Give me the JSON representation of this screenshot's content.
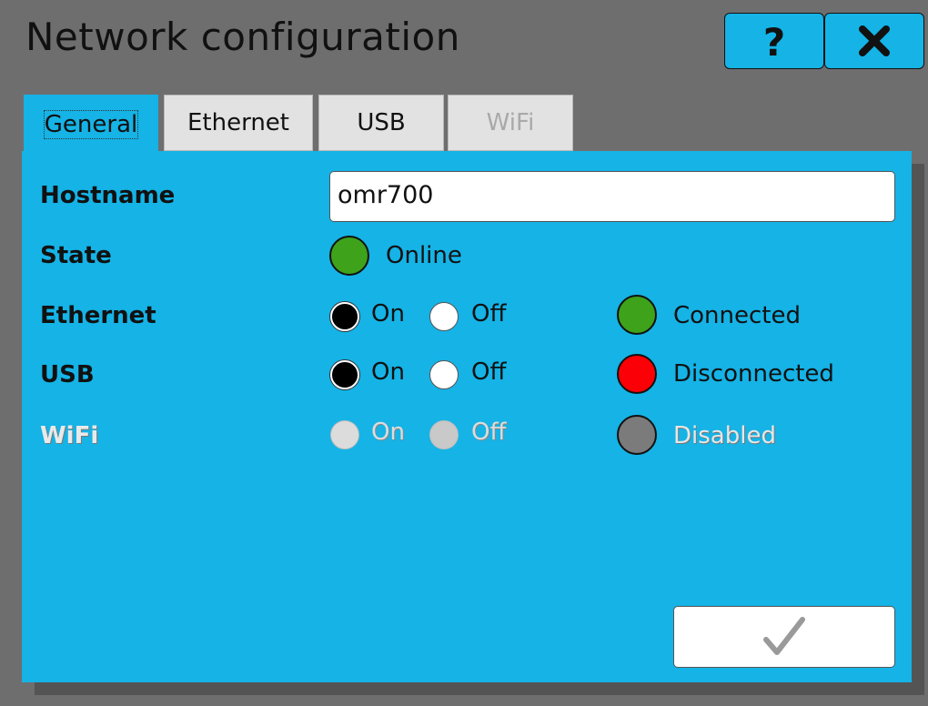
{
  "window": {
    "title": "Network configuration"
  },
  "toolbar": {
    "help_icon": "question-mark-icon",
    "close_icon": "close-x-icon"
  },
  "tabs": [
    {
      "label": "General",
      "state": "active"
    },
    {
      "label": "Ethernet",
      "state": "normal"
    },
    {
      "label": "USB",
      "state": "normal"
    },
    {
      "label": "WiFi",
      "state": "disabled"
    }
  ],
  "general": {
    "hostname": {
      "label": "Hostname",
      "value": "omr700"
    },
    "state": {
      "label": "State",
      "status": "Online",
      "color": "#3ea21a"
    },
    "ethernet": {
      "label": "Ethernet",
      "on": "On",
      "off": "Off",
      "selected": "On",
      "status": "Connected",
      "color": "#3ea21a"
    },
    "usb": {
      "label": "USB",
      "on": "On",
      "off": "Off",
      "selected": "On",
      "status": "Disconnected",
      "color": "#fb0006"
    },
    "wifi": {
      "label": "WiFi",
      "on": "On",
      "off": "Off",
      "selected": "none",
      "enabled": false,
      "status": "Disabled",
      "color": "#7c7b7c"
    }
  },
  "footer": {
    "confirm_icon": "checkmark-icon"
  },
  "colors": {
    "accent": "#15b3e6",
    "background": "#6f6e6f"
  }
}
